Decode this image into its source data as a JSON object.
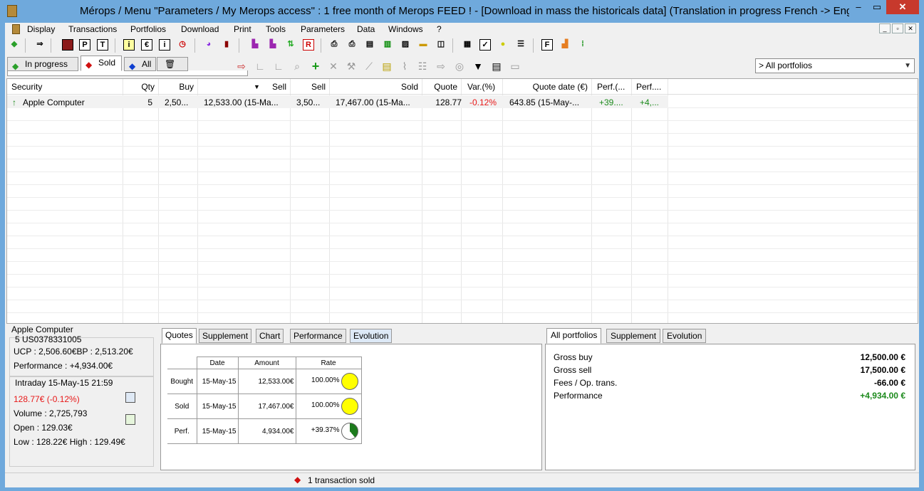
{
  "window": {
    "title": "Mérops / Menu \"Parameters / My Merops access\" : 1 free month of Merops FEED ! - [Download in mass the historicals data] (Translation in progress French -> Engl"
  },
  "menu": [
    "Display",
    "Transactions",
    "Portfolios",
    "Download",
    "Print",
    "Tools",
    "Parameters",
    "Data",
    "Windows",
    "?"
  ],
  "portfolio_tabs": [
    "In progress",
    "Sold",
    "All"
  ],
  "portfolio_selector": "> All portfolios",
  "grid": {
    "columns": [
      "Security",
      "Qty",
      "Buy",
      "",
      "Sell",
      "Sell",
      "Sold",
      "Quote",
      "Var.(%)",
      "Quote date (€)",
      "Perf.(...",
      "Perf...."
    ],
    "rows": [
      {
        "security": "Apple Computer",
        "qty": "5",
        "buy": "2,50...",
        "buy_amount": "12,533.00 (15-Ma...",
        "sell": "3,50...",
        "sold": "17,467.00 (15-Ma...",
        "quote": "128.77",
        "var": "-0.12%",
        "quote_date": "643.85 (15-May-...",
        "perf1": "+39....",
        "perf2": "+4,..."
      }
    ]
  },
  "info": {
    "title": "Apple Computer",
    "isin": "5 US0378331005",
    "ucp": "UCP : 2,506.60€BP : 2,513.20€",
    "performance": "Performance : +4,934.00€",
    "intraday": "Intraday 15-May-15 21:59",
    "quote": "128.77€ (-0.12%)",
    "volume": "Volume : 2,725,793",
    "open": "Open : 129.03€",
    "lowhigh": "Low : 128.22€ High : 129.49€"
  },
  "detail_tabs": [
    "Quotes",
    "Supplement",
    "Chart",
    "Performance",
    "Evolution"
  ],
  "quotes_table": {
    "headers": [
      "Date",
      "Amount",
      "Rate"
    ],
    "rows": [
      {
        "label": "Bought",
        "date": "15-May-15",
        "amount": "12,533.00€",
        "rate": "100.00%",
        "circle": "full"
      },
      {
        "label": "Sold",
        "date": "15-May-15",
        "amount": "17,467.00€",
        "rate": "100.00%",
        "circle": "full"
      },
      {
        "label": "Perf.",
        "date": "15-May-15",
        "amount": "4,934.00€",
        "rate": "+39.37%",
        "circle": "partial"
      }
    ]
  },
  "summary_tabs": [
    "All portfolios",
    "Supplement",
    "Evolution"
  ],
  "summary": [
    {
      "label": "Gross buy",
      "value": "12,500.00 €"
    },
    {
      "label": "Gross sell",
      "value": "17,500.00 €"
    },
    {
      "label": "Fees / Op. trans.",
      "value": "-66.00 €"
    },
    {
      "label": "Performance",
      "value": "+4,934.00 €"
    }
  ],
  "status": "1 transaction sold",
  "colors": {
    "up": "#1c8a1c",
    "down": "#e81818",
    "titlebar": "#6fa9dc",
    "coin": "#ffff00"
  }
}
